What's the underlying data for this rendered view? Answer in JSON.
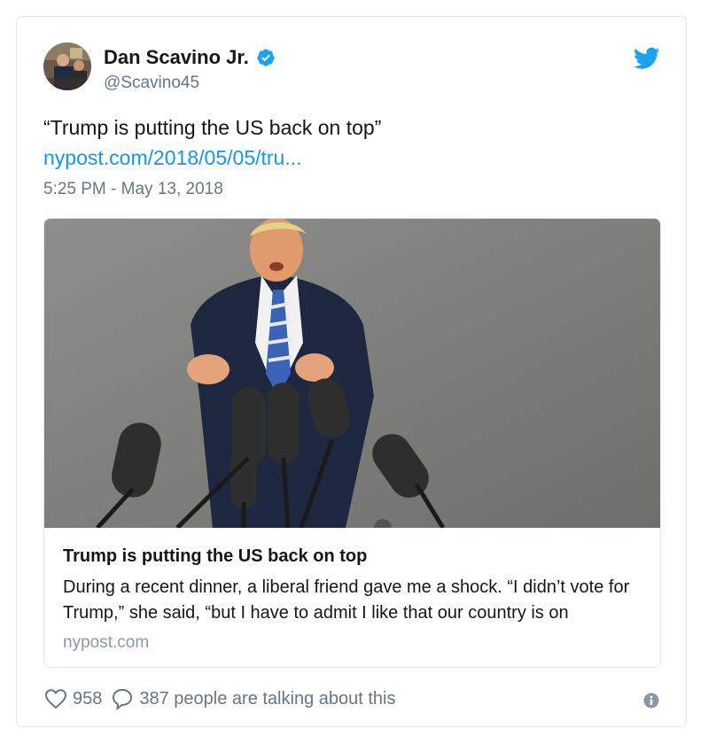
{
  "author": {
    "display_name": "Dan Scavino Jr.",
    "handle": "@Scavino45",
    "verified": true
  },
  "tweet": {
    "text": "“Trump is putting the US back on top”",
    "link_text": "nypost.com/2018/05/05/tru...",
    "timestamp": "5:25 PM - May 13, 2018"
  },
  "link_card": {
    "title": "Trump is putting the US back on top",
    "description": "During a recent dinner, a liberal friend gave me a shock. “I didn’t vote for Trump,” she said, “but I have to admit I like that our country is on",
    "domain": "nypost.com"
  },
  "actions": {
    "likes": "958",
    "conversation": "387 people are talking about this"
  },
  "colors": {
    "twitter_blue": "#1da1f2",
    "link": "#1b95e0",
    "text": "#14171a",
    "muted": "#657786",
    "border": "#e1e8ed"
  },
  "icons": [
    "twitter-bird-icon",
    "verified-badge-icon",
    "heart-icon",
    "reply-bubble-icon",
    "info-icon"
  ]
}
